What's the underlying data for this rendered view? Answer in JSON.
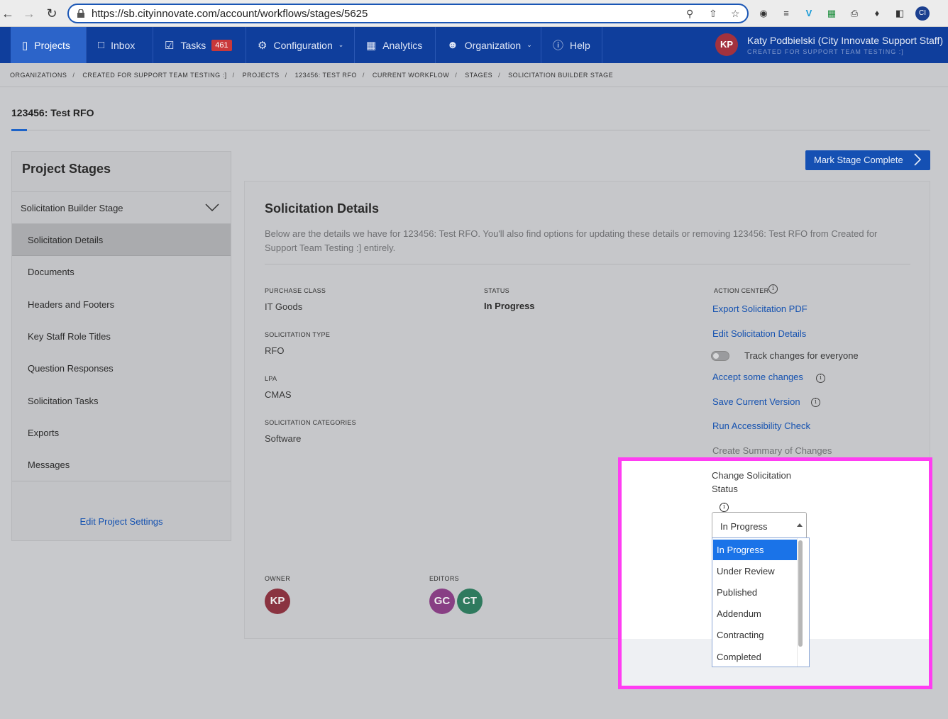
{
  "browser": {
    "url": "https://sb.cityinnovate.com/account/workflows/stages/5625"
  },
  "nav": {
    "projects": "Projects",
    "inbox": "Inbox",
    "tasks": "Tasks",
    "tasks_badge": "461",
    "configuration": "Configuration",
    "analytics": "Analytics",
    "organization": "Organization",
    "help": "Help",
    "user_initials": "KP",
    "user_name": "Katy Podbielski (City Innovate Support Staff)",
    "user_org": "CREATED FOR SUPPORT TEAM TESTING :]"
  },
  "breadcrumb": [
    "ORGANIZATIONS",
    "CREATED FOR SUPPORT TEAM TESTING :]",
    "PROJECTS",
    "123456: TEST RFO",
    "CURRENT WORKFLOW",
    "STAGES",
    "SOLICITATION BUILDER STAGE"
  ],
  "project_title": "123456: Test RFO",
  "sidebar": {
    "heading": "Project Stages",
    "stage": "Solicitation Builder Stage",
    "items": [
      "Solicitation Details",
      "Documents",
      "Headers and Footers",
      "Key Staff Role Titles",
      "Question Responses",
      "Solicitation Tasks",
      "Exports",
      "Messages"
    ],
    "edit_settings": "Edit Project Settings"
  },
  "mark_complete": "Mark Stage Complete",
  "details": {
    "heading": "Solicitation Details",
    "description": "Below are the details we have for 123456: Test RFO. You'll also find options for updating these details or removing 123456: Test RFO from Created for Support Team Testing :] entirely.",
    "purchase_class_label": "PURCHASE CLASS",
    "purchase_class": "IT Goods",
    "status_label": "STATUS",
    "status": "In Progress",
    "solicitation_type_label": "SOLICITATION TYPE",
    "solicitation_type": "RFO",
    "lpa_label": "LPA",
    "lpa": "CMAS",
    "categories_label": "SOLICITATION CATEGORIES",
    "categories": "Software",
    "owner_label": "OWNER",
    "owner_initials": "KP",
    "editors_label": "EDITORS",
    "editors": [
      "GC",
      "CT"
    ]
  },
  "action_center": {
    "label": "ACTION CENTER",
    "export_pdf": "Export Solicitation PDF",
    "edit_details": "Edit Solicitation Details",
    "track_changes": "Track changes for everyone",
    "accept_changes": "Accept some changes",
    "save_version": "Save Current Version",
    "run_check": "Run Accessibility Check",
    "summary": "Create Summary of Changes",
    "change_status_label": "Change Solicitation Status",
    "selected_status": "In Progress",
    "status_options": [
      "In Progress",
      "Under Review",
      "Published",
      "Addendum",
      "Contracting",
      "Completed"
    ]
  },
  "colors": {
    "nav_bg": "#0f3e9c",
    "nav_active": "#2c64c9",
    "link": "#1552b0",
    "highlight_border": "#ff3df2",
    "selected_option": "#1a73e8",
    "badge": "#c9383a"
  }
}
